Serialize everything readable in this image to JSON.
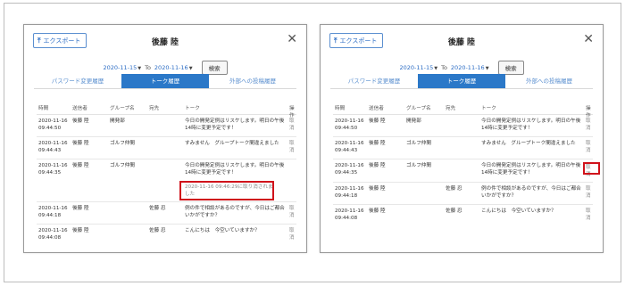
{
  "panels": [
    {
      "export_label": "エクスポート",
      "title": "後藤 陸",
      "date_from": "2020-11-15",
      "to_label": "To",
      "date_to": "2020-11-16",
      "search_label": "検索",
      "tabs": [
        {
          "label": "パスワード変更履歴",
          "active": false
        },
        {
          "label": "トーク履歴",
          "active": true
        },
        {
          "label": "外部への投稿履歴",
          "active": false
        }
      ],
      "headers": {
        "time": "時間",
        "sender": "送信者",
        "group": "グループ名",
        "dest": "宛先",
        "talk": "トーク",
        "action": "操作"
      },
      "rows": [
        {
          "date": "2020-11-16",
          "time": "09:44:50",
          "sender": "後藤 陸",
          "group": "開発部",
          "dest": "",
          "talk": "今日の開発定例はリスケします。明日の午後14時に変更予定です！",
          "action": "取消"
        },
        {
          "date": "2020-11-16",
          "time": "09:44:43",
          "sender": "後藤 陸",
          "group": "ゴルフ仲間",
          "dest": "",
          "talk": "すみません　グループトーク間違えました",
          "action": "取消"
        },
        {
          "date": "2020-11-16",
          "time": "09:44:35",
          "sender": "後藤 陸",
          "group": "ゴルフ仲間",
          "dest": "",
          "talk": "今日の開発定例はリスケします。明日の午後14時に変更予定です！",
          "retracted": "2020-11-16 09:46:29に取り消されました",
          "action": ""
        },
        {
          "date": "2020-11-16",
          "time": "09:44:18",
          "sender": "後藤 陸",
          "group": "",
          "dest": "佐藤 忍",
          "talk": "例の件で相談があるのですが、今日はご都合いかがですか？",
          "action": "取消"
        },
        {
          "date": "2020-11-16",
          "time": "09:44:08",
          "sender": "後藤 陸",
          "group": "",
          "dest": "佐藤 忍",
          "talk": "こんにちは　今空いていますか？",
          "action": "取消"
        }
      ]
    },
    {
      "export_label": "エクスポート",
      "title": "後藤 陸",
      "date_from": "2020-11-15",
      "to_label": "To",
      "date_to": "2020-11-16",
      "search_label": "検索",
      "tabs": [
        {
          "label": "パスワード変更履歴",
          "active": false
        },
        {
          "label": "トーク履歴",
          "active": true
        },
        {
          "label": "外部への投稿履歴",
          "active": false
        }
      ],
      "headers": {
        "time": "時間",
        "sender": "送信者",
        "group": "グループ名",
        "dest": "宛先",
        "talk": "トーク",
        "action": "操作"
      },
      "rows": [
        {
          "date": "2020-11-16",
          "time": "09:44:50",
          "sender": "後藤 陸",
          "group": "開発部",
          "dest": "",
          "talk": "今日の開発定例はリスケします。明日の午後14時に変更予定です！",
          "action": "取消"
        },
        {
          "date": "2020-11-16",
          "time": "09:44:43",
          "sender": "後藤 陸",
          "group": "ゴルフ仲間",
          "dest": "",
          "talk": "すみません　グループトーク間違えました",
          "action": "取消"
        },
        {
          "date": "2020-11-16",
          "time": "09:44:35",
          "sender": "後藤 陸",
          "group": "ゴルフ仲間",
          "dest": "",
          "talk": "今日の開発定例はリスケします。明日の午後14時に変更予定です！",
          "action": "取消"
        },
        {
          "date": "2020-11-16",
          "time": "09:44:18",
          "sender": "後藤 陸",
          "group": "",
          "dest": "佐藤 忍",
          "talk": "例の件で相談があるのですが、今日はご都合いかがですか？",
          "action": "取消"
        },
        {
          "date": "2020-11-16",
          "time": "09:44:08",
          "sender": "後藤 陸",
          "group": "",
          "dest": "佐藤 忍",
          "talk": "こんにちは　今空いていますか？",
          "action": "取消"
        }
      ]
    }
  ],
  "colors": {
    "accent": "#2b78c8",
    "highlight": "#d0121b"
  }
}
